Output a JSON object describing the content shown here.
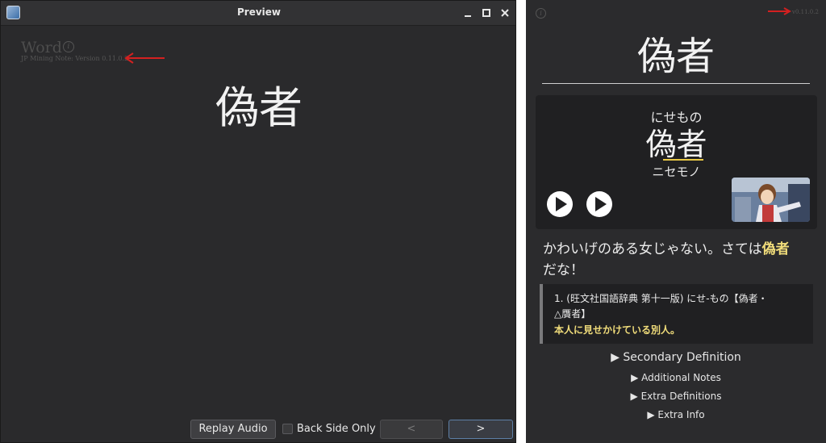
{
  "window": {
    "title": "Preview",
    "field_name": "Word",
    "version": "JP Mining Note: Version 0.11.0.2",
    "word": "偽者",
    "buttons": {
      "replay_audio": "Replay Audio",
      "back_side_only": "Back Side Only",
      "prev": "<",
      "next": ">"
    }
  },
  "card": {
    "version": "v0.11.0.2",
    "word": "偽者",
    "reading": "にせもの",
    "katakana": "ニセモノ",
    "sentence_before": "かわいげのある女じゃない。さては",
    "sentence_highlight": "偽者",
    "sentence_after": "だな！",
    "definition": {
      "line1": "1. (旺文社国語辞典 第十一版) にせ‐もの【偽者・",
      "line2": "△贋者】",
      "line3": "本人に見せかけている別人。"
    },
    "sections": [
      "▶ Secondary Definition",
      "▶ Additional Notes",
      "▶ Extra Definitions",
      "▶ Extra Info"
    ]
  },
  "colors": {
    "annotation_arrow": "#d42020",
    "highlight": "#f0dc7a",
    "pitch_line": "#e9c845"
  }
}
